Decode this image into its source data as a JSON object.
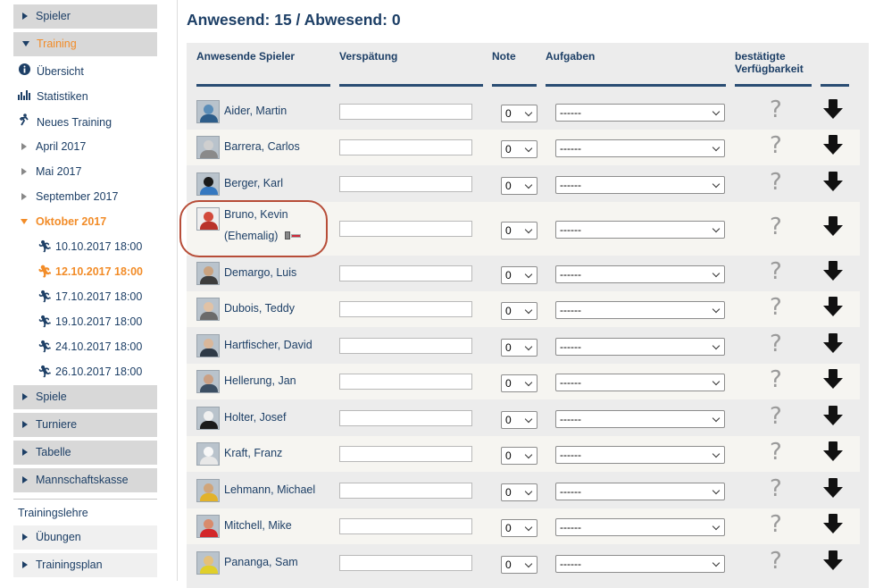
{
  "sidebar": {
    "spieler": "Spieler",
    "training": "Training",
    "uebersicht": "Übersicht",
    "statistiken": "Statistiken",
    "neues_training": "Neues Training",
    "months": [
      "April 2017",
      "Mai 2017",
      "September 2017",
      "Oktober 2017"
    ],
    "sessions": [
      "10.10.2017 18:00",
      "12.10.2017 18:00",
      "17.10.2017 18:00",
      "19.10.2017 18:00",
      "24.10.2017 18:00",
      "26.10.2017 18:00"
    ],
    "spiele": "Spiele",
    "turniere": "Turniere",
    "tabelle": "Tabelle",
    "mannschaftskasse": "Mannschaftskasse",
    "trainingslehre": "Trainingslehre",
    "uebungen": "Übungen",
    "trainingsplan": "Trainingsplan"
  },
  "main": {
    "title": "Anwesend: 15 / Abwesend: 0",
    "headers": {
      "player": "Anwesende Spieler",
      "late": "Verspätung",
      "note": "Note",
      "tasks": "Aufgaben",
      "availability": "bestätigte Verfügbarkeit"
    },
    "default_note": "0",
    "default_task": "------",
    "unknown_mark": "?",
    "players": [
      {
        "name": "Aider, Martin"
      },
      {
        "name": "Barrera, Carlos"
      },
      {
        "name": "Berger, Karl"
      },
      {
        "name": "Bruno, Kevin",
        "sub": "(Ehemalig)"
      },
      {
        "name": "Demargo, Luis"
      },
      {
        "name": "Dubois, Teddy"
      },
      {
        "name": "Hartfischer, David"
      },
      {
        "name": "Hellerung, Jan"
      },
      {
        "name": "Holter, Josef"
      },
      {
        "name": "Kraft, Franz"
      },
      {
        "name": "Lehmann, Michael"
      },
      {
        "name": "Mitchell, Mike"
      },
      {
        "name": "Pananga, Sam"
      }
    ]
  },
  "colors": {
    "navy": "#1d3f66",
    "orange": "#f28c28",
    "highlight_circle": "#b74d38"
  }
}
